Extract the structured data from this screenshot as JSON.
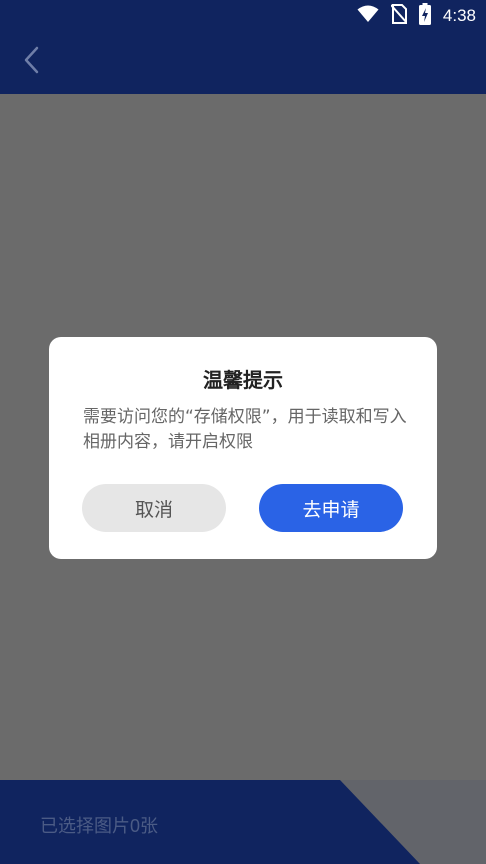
{
  "status_bar": {
    "time": "4:38",
    "icons": [
      "wifi-icon",
      "no-sim-icon",
      "battery-charging-icon"
    ]
  },
  "app_bar": {
    "back_icon": "chevron-left-icon"
  },
  "dialog": {
    "title": "温馨提示",
    "message": "需要访问您的“存储权限”，用于读取和写入相册内容，请开启权限",
    "cancel_label": "取消",
    "confirm_label": "去申请"
  },
  "bottom_bar": {
    "selected_label": "已选择图片0张"
  },
  "colors": {
    "header": "#10245f",
    "overlay": "#6b6b6b",
    "primary_button": "#2a63e6",
    "secondary_button": "#e6e6e6"
  }
}
